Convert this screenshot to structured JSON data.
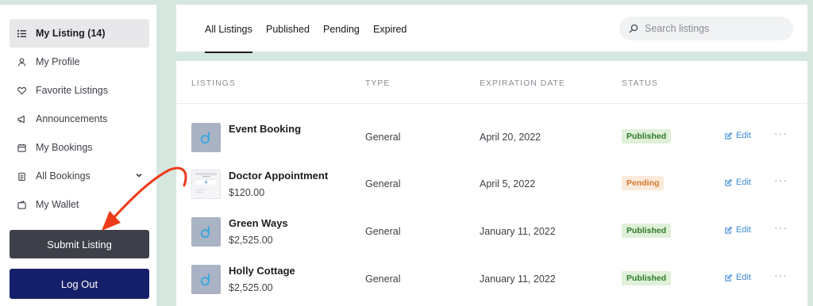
{
  "sidebar": {
    "items": [
      {
        "label": "My Listing (14)",
        "icon": "list-icon"
      },
      {
        "label": "My Profile",
        "icon": "user-icon"
      },
      {
        "label": "Favorite Listings",
        "icon": "heart-icon"
      },
      {
        "label": "Announcements",
        "icon": "megaphone-icon"
      },
      {
        "label": "My Bookings",
        "icon": "calendar-icon"
      },
      {
        "label": "All Bookings",
        "icon": "clipboard-icon"
      },
      {
        "label": "My Wallet",
        "icon": "wallet-icon"
      }
    ],
    "submit_label": "Submit Listing",
    "logout_label": "Log Out"
  },
  "tabs": [
    "All Listings",
    "Published",
    "Pending",
    "Expired"
  ],
  "search": {
    "placeholder": "Search listings"
  },
  "table": {
    "headers": {
      "listings": "LISTINGS",
      "type": "TYPE",
      "expiration": "EXPIRATION DATE",
      "status": "STATUS"
    },
    "edit_label": "Edit",
    "more_label": "···",
    "rows": [
      {
        "title": "Event Booking",
        "price": "",
        "type": "General",
        "date": "April 20, 2022",
        "status": "Published"
      },
      {
        "title": "Doctor Appointment",
        "price": "$120.00",
        "type": "General",
        "date": "April 5, 2022",
        "status": "Pending"
      },
      {
        "title": "Green Ways",
        "price": "$2,525.00",
        "type": "General",
        "date": "January 11, 2022",
        "status": "Published"
      },
      {
        "title": "Holly Cottage",
        "price": "$2,525.00",
        "type": "General",
        "date": "January 11, 2022",
        "status": "Published"
      }
    ]
  },
  "colors": {
    "background": "#d6e7df",
    "logout_button": "#16206a",
    "submit_button": "#3d4049",
    "published_badge": "#dff0d8",
    "pending_badge": "#fbeadb",
    "edit_link": "#3b8bd6",
    "annotation_arrow": "#ee3b1a"
  }
}
